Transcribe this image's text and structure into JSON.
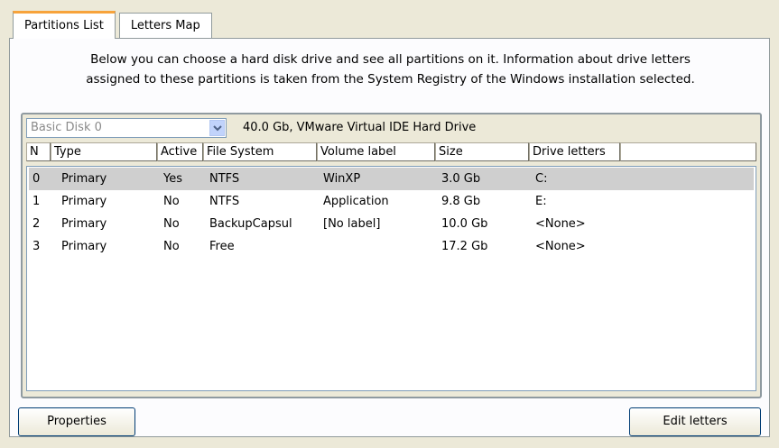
{
  "tabs": [
    {
      "label": "Partitions List"
    },
    {
      "label": "Letters Map"
    }
  ],
  "description": {
    "line1": "Below you can choose a hard disk drive and see all partitions on it. Information about drive letters",
    "line2": "assigned to these partitions is taken from the System Registry of the Windows installation selected."
  },
  "disk_select": {
    "value": "Basic Disk 0",
    "info": "40.0 Gb, VMware Virtual IDE Hard Drive"
  },
  "columns": [
    "N",
    "Type",
    "Active",
    "File System",
    "Volume label",
    "Size",
    "Drive letters"
  ],
  "rows": [
    {
      "n": "0",
      "type": "Primary",
      "active": "Yes",
      "fs": "NTFS",
      "label": "WinXP",
      "size": "3.0 Gb",
      "letters": "C:"
    },
    {
      "n": "1",
      "type": "Primary",
      "active": "No",
      "fs": "NTFS",
      "label": "Application",
      "size": "9.8 Gb",
      "letters": "E:"
    },
    {
      "n": "2",
      "type": "Primary",
      "active": "No",
      "fs": "BackupCapsul",
      "label": "[No label]",
      "size": "10.0 Gb",
      "letters": "<None>"
    },
    {
      "n": "3",
      "type": "Primary",
      "active": "No",
      "fs": "Free",
      "label": "",
      "size": "17.2 Gb",
      "letters": "<None>"
    }
  ],
  "buttons": {
    "properties": "Properties",
    "edit_letters": "Edit letters"
  }
}
